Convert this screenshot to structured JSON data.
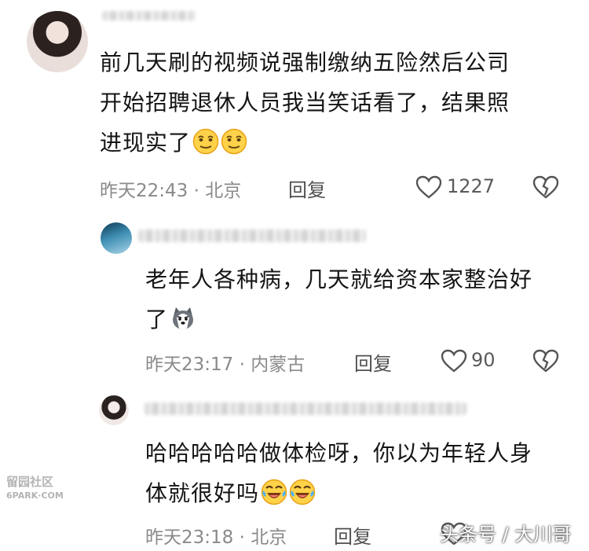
{
  "comments": [
    {
      "text_lines": [
        "前几天刷的视频说强制缴纳五险然后公司",
        "开始招聘退休人员我当笑话看了，结果照",
        "进现实了"
      ],
      "emoji": [
        "grimace-emoji",
        "grimace-emoji"
      ],
      "time_loc": "昨天22:43 · 北京",
      "reply_label": "回复",
      "likes": "1227"
    },
    {
      "text_lines": [
        "老年人各种病，几天就给资本家整治好",
        "了"
      ],
      "emoji": [
        "husky-dog-emoji"
      ],
      "time_loc": "昨天23:17 · 内蒙古",
      "reply_label": "回复",
      "likes": "90"
    },
    {
      "text_lines": [
        "哈哈哈哈哈做体检呀，你以为年轻人身",
        "体就很好吗"
      ],
      "emoji": [
        "laugh-cry-emoji",
        "laugh-cry-emoji"
      ],
      "time_loc": "昨天23:18 · 北京",
      "reply_label": "回复"
    }
  ],
  "watermarks": {
    "left_line1": "留园社区",
    "left_line2": "6PARK·COM",
    "right": "头条号 / 大川哥"
  },
  "icons": {
    "like": "heart-outline-icon",
    "dislike": "broken-heart-icon"
  }
}
